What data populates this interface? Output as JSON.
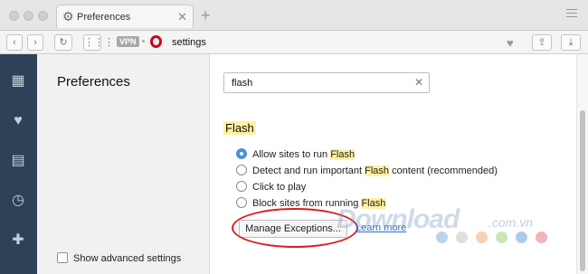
{
  "tab": {
    "title": "Preferences",
    "icon": "gear-icon"
  },
  "addressbar": {
    "vpn_label": "VPN",
    "url": "settings"
  },
  "sidebar": {
    "icons": [
      "speed-dial-icon",
      "heart-icon",
      "news-icon",
      "history-icon",
      "extensions-icon"
    ]
  },
  "left_panel": {
    "title": "Preferences",
    "advanced_label": "Show advanced settings"
  },
  "search": {
    "value": "flash"
  },
  "flash": {
    "title": "Flash",
    "options": [
      {
        "before": "Allow sites to run ",
        "highlight": "Flash",
        "after": "",
        "selected": true
      },
      {
        "before": "Detect and run important ",
        "highlight": "Flash",
        "after": " content (recommended)",
        "selected": false
      },
      {
        "before": "Click to play",
        "highlight": "",
        "after": "",
        "selected": false
      },
      {
        "before": "Block sites from running ",
        "highlight": "Flash",
        "after": "",
        "selected": false
      }
    ],
    "manage_button": "Manage Exceptions...",
    "learn_more": "Learn more"
  },
  "watermark": {
    "main": "Download",
    "suffix": ".com.vn"
  },
  "colors": {
    "sidebar": "#2d4257",
    "highlight": "#fff2a0",
    "accent": "#4a90d9",
    "annotation": "#d82020"
  }
}
